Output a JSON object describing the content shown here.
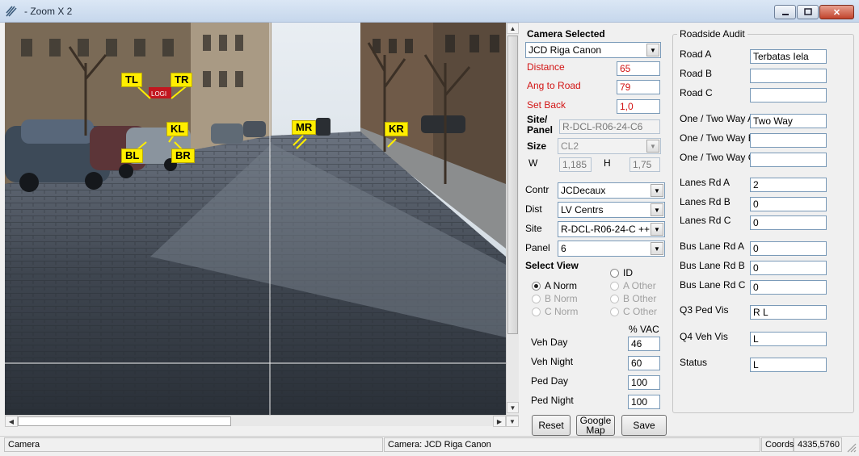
{
  "window": {
    "title": "- Zoom X 2"
  },
  "image": {
    "tags": [
      "TL",
      "TR",
      "KL",
      "BL",
      "BR",
      "MR",
      "KR"
    ],
    "sign_text": "LOGI"
  },
  "camera": {
    "header": "Camera Selected",
    "selected": "JCD Riga Canon",
    "distance_label": "Distance",
    "distance_value": "65",
    "ang_label": "Ang to Road",
    "ang_value": "79",
    "setback_label": "Set Back",
    "setback_value": "1,0",
    "site_panel_label_1": "Site/",
    "site_panel_label_2": "Panel",
    "site_panel_value": "R-DCL-R06-24-C6",
    "size_label": "Size",
    "size_value": "CL2",
    "w_label": "W",
    "w_value": "1,185",
    "h_label": "H",
    "h_value": "1,75",
    "contr_label": "Contr",
    "contr_value": "JCDecaux",
    "dist_label": "Dist",
    "dist_value": "LV Centrs",
    "site_label": "Site",
    "site_value": "R-DCL-R06-24-C ++",
    "panel_label": "Panel",
    "panel_value": "6"
  },
  "select_view": {
    "header": "Select View",
    "options": [
      "ID",
      "A Norm",
      "A Other",
      "B Norm",
      "B Other",
      "C Norm",
      "C Other"
    ]
  },
  "vac": {
    "header": "% VAC",
    "veh_day_label": "Veh Day",
    "veh_day": "46",
    "veh_night_label": "Veh Night",
    "veh_night": "60",
    "ped_day_label": "Ped Day",
    "ped_day": "100",
    "ped_night_label": "Ped Night",
    "ped_night": "100"
  },
  "buttons": {
    "reset": "Reset",
    "google_map_1": "Google",
    "google_map_2": "Map",
    "save": "Save"
  },
  "audit": {
    "header": "Roadside Audit",
    "rows": [
      {
        "label": "Road A",
        "value": "Terbatas Iela"
      },
      {
        "label": "Road B",
        "value": ""
      },
      {
        "label": "Road C",
        "value": ""
      },
      {
        "label": "One / Two Way A",
        "value": "Two Way"
      },
      {
        "label": "One / Two Way B",
        "value": ""
      },
      {
        "label": "One / Two Way C",
        "value": ""
      },
      {
        "label": "Lanes Rd A",
        "value": "2"
      },
      {
        "label": "Lanes Rd B",
        "value": "0"
      },
      {
        "label": "Lanes Rd C",
        "value": "0"
      },
      {
        "label": "Bus Lane Rd A",
        "value": "0"
      },
      {
        "label": "Bus Lane Rd B",
        "value": "0"
      },
      {
        "label": "Bus Lane Rd C",
        "value": "0"
      },
      {
        "label": "Q3 Ped Vis",
        "value": "R  L"
      },
      {
        "label": "Q4 Veh Vis",
        "value": "L"
      },
      {
        "label": "Status",
        "value": "L"
      }
    ]
  },
  "status": {
    "left": "Camera",
    "middle": "Camera: JCD Riga Canon",
    "coords_label": "Coords",
    "coords_value": "4335,5760"
  }
}
